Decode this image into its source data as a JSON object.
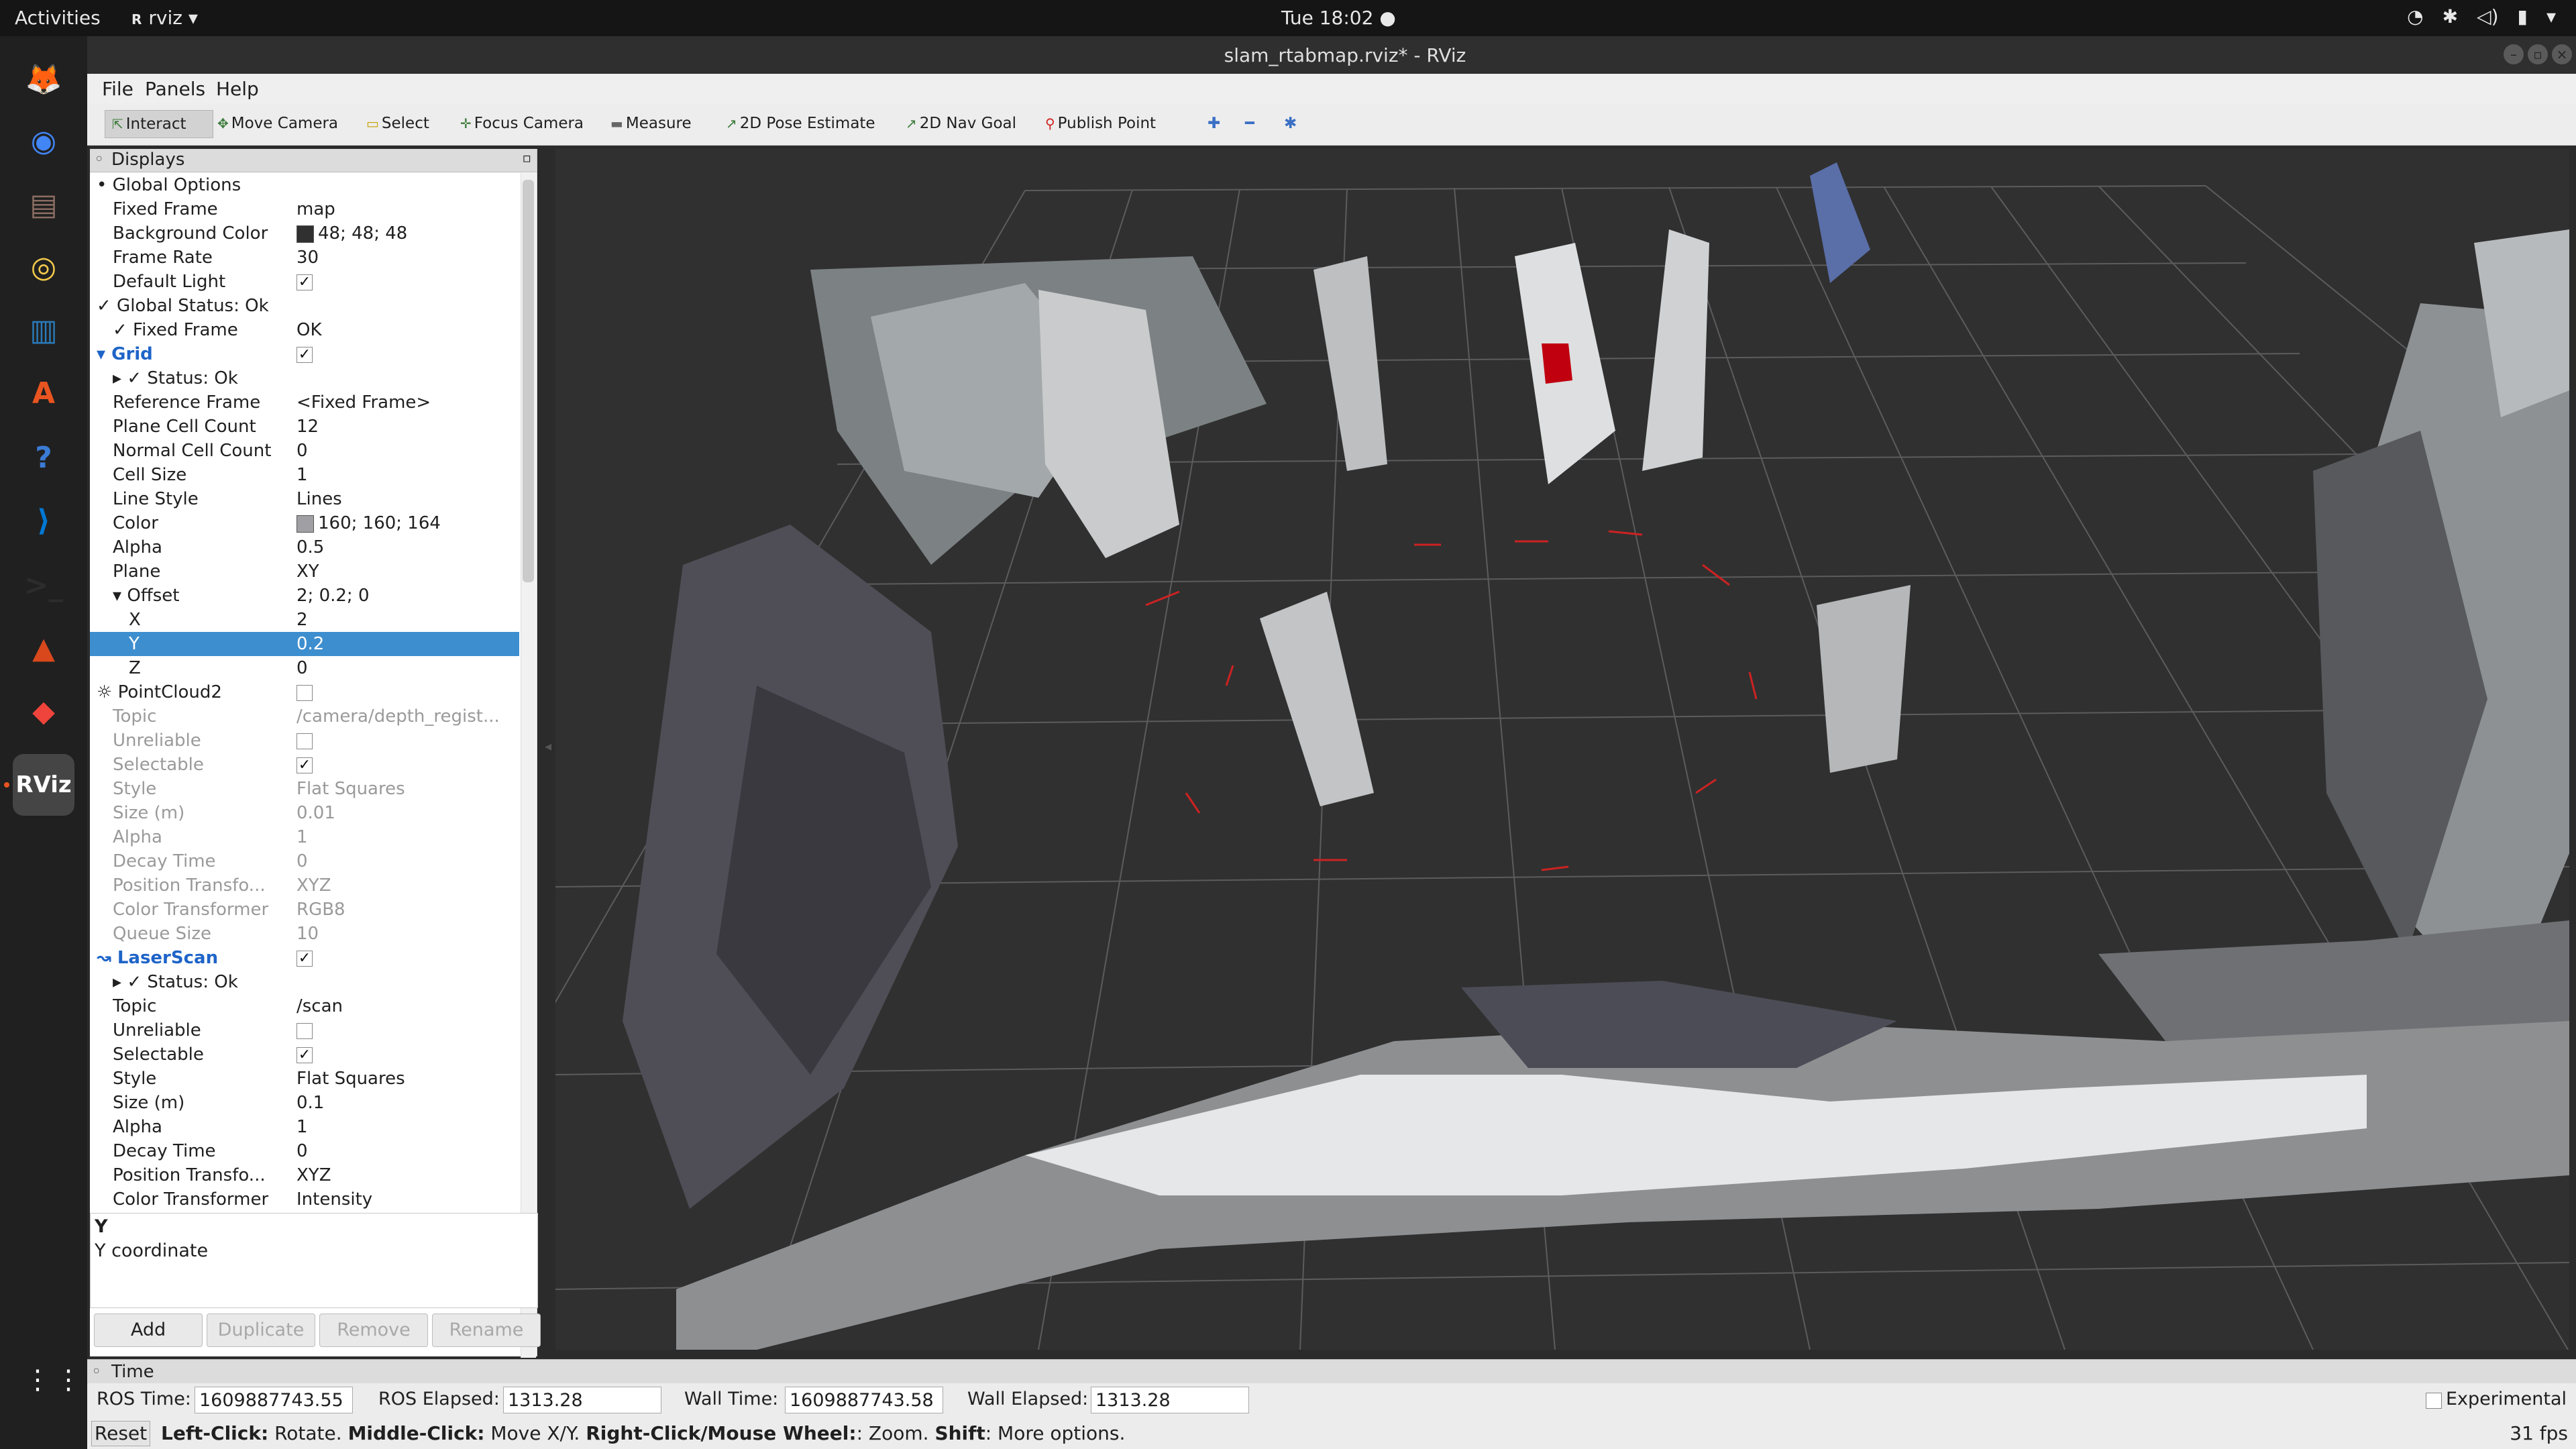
{
  "topbar": {
    "activities": "Activities",
    "app_name": "rviz",
    "clock": "Tue 18:02"
  },
  "window": {
    "title": "slam_rtabmap.rviz* - RViz"
  },
  "menu": [
    "File",
    "Panels",
    "Help"
  ],
  "toolbar": {
    "tools": [
      {
        "label": "Interact",
        "icon": "cursor-icon",
        "active": true
      },
      {
        "label": "Move Camera",
        "icon": "move-camera-icon",
        "active": false
      },
      {
        "label": "Select",
        "icon": "select-icon",
        "active": false
      },
      {
        "label": "Focus Camera",
        "icon": "focus-icon",
        "active": false
      },
      {
        "label": "Measure",
        "icon": "ruler-icon",
        "active": false
      },
      {
        "label": "2D Pose Estimate",
        "icon": "green-arrow-icon",
        "active": false
      },
      {
        "label": "2D Nav Goal",
        "icon": "green-arrow-icon",
        "active": false
      },
      {
        "label": "Publish Point",
        "icon": "red-pin-icon",
        "active": false
      }
    ]
  },
  "displays": {
    "title": "Displays",
    "rows": [
      {
        "key": "Global Options",
        "value": "",
        "indent": 0,
        "icon": "•"
      },
      {
        "key": "Fixed Frame",
        "value": "map",
        "indent": 1
      },
      {
        "key": "Background Color",
        "value": "48; 48; 48",
        "indent": 1,
        "swatch": "#303030"
      },
      {
        "key": "Frame Rate",
        "value": "30",
        "indent": 1
      },
      {
        "key": "Default Light",
        "value": "✓",
        "indent": 1,
        "check": true
      },
      {
        "key": "Global Status: Ok",
        "value": "",
        "indent": 0,
        "icon": "✓"
      },
      {
        "key": "Fixed Frame",
        "value": "OK",
        "indent": 1,
        "icon": "✓"
      },
      {
        "key": "Grid",
        "value": "✓",
        "indent": 0,
        "icon": "▾",
        "blue": true,
        "check": true
      },
      {
        "key": "Status: Ok",
        "value": "",
        "indent": 1,
        "icon": "▸ ✓"
      },
      {
        "key": "Reference Frame",
        "value": "<Fixed Frame>",
        "indent": 1
      },
      {
        "key": "Plane Cell Count",
        "value": "12",
        "indent": 1
      },
      {
        "key": "Normal Cell Count",
        "value": "0",
        "indent": 1
      },
      {
        "key": "Cell Size",
        "value": "1",
        "indent": 1
      },
      {
        "key": "Line Style",
        "value": "Lines",
        "indent": 1
      },
      {
        "key": "Color",
        "value": "160; 160; 164",
        "indent": 1,
        "swatch": "#a0a0a4"
      },
      {
        "key": "Alpha",
        "value": "0.5",
        "indent": 1
      },
      {
        "key": "Plane",
        "value": "XY",
        "indent": 1
      },
      {
        "key": "Offset",
        "value": "2; 0.2; 0",
        "indent": 1,
        "icon": "▾"
      },
      {
        "key": "X",
        "value": "2",
        "indent": 2
      },
      {
        "key": "Y",
        "value": "0.2",
        "indent": 2,
        "selected": true
      },
      {
        "key": "Z",
        "value": "0",
        "indent": 2
      },
      {
        "key": "PointCloud2",
        "value": "",
        "indent": 0,
        "icon": "☼",
        "check": true
      },
      {
        "key": "Topic",
        "value": "/camera/depth_regist...",
        "indent": 1,
        "dim": true
      },
      {
        "key": "Unreliable",
        "value": "",
        "indent": 1,
        "dim": true,
        "check": true
      },
      {
        "key": "Selectable",
        "value": "✓",
        "indent": 1,
        "dim": true,
        "check": true
      },
      {
        "key": "Style",
        "value": "Flat Squares",
        "indent": 1,
        "dim": true
      },
      {
        "key": "Size (m)",
        "value": "0.01",
        "indent": 1,
        "dim": true
      },
      {
        "key": "Alpha",
        "value": "1",
        "indent": 1,
        "dim": true
      },
      {
        "key": "Decay Time",
        "value": "0",
        "indent": 1,
        "dim": true
      },
      {
        "key": "Position Transfo...",
        "value": "XYZ",
        "indent": 1,
        "dim": true
      },
      {
        "key": "Color Transformer",
        "value": "RGB8",
        "indent": 1,
        "dim": true
      },
      {
        "key": "Queue Size",
        "value": "10",
        "indent": 1,
        "dim": true
      },
      {
        "key": "LaserScan",
        "value": "✓",
        "indent": 0,
        "icon": "↝",
        "blue": true,
        "check": true
      },
      {
        "key": "Status: Ok",
        "value": "",
        "indent": 1,
        "icon": "▸ ✓"
      },
      {
        "key": "Topic",
        "value": "/scan",
        "indent": 1
      },
      {
        "key": "Unreliable",
        "value": "",
        "indent": 1,
        "check": true
      },
      {
        "key": "Selectable",
        "value": "✓",
        "indent": 1,
        "check": true
      },
      {
        "key": "Style",
        "value": "Flat Squares",
        "indent": 1
      },
      {
        "key": "Size (m)",
        "value": "0.1",
        "indent": 1
      },
      {
        "key": "Alpha",
        "value": "1",
        "indent": 1
      },
      {
        "key": "Decay Time",
        "value": "0",
        "indent": 1
      },
      {
        "key": "Position Transfo...",
        "value": "XYZ",
        "indent": 1
      },
      {
        "key": "Color Transformer",
        "value": "Intensity",
        "indent": 1
      }
    ]
  },
  "description": {
    "title": "Y",
    "text": "Y coordinate"
  },
  "display_buttons": [
    {
      "label": "Add",
      "enabled": true
    },
    {
      "label": "Duplicate",
      "enabled": false
    },
    {
      "label": "Remove",
      "enabled": false
    },
    {
      "label": "Rename",
      "enabled": false
    }
  ],
  "time_panel": {
    "title": "Time",
    "ros_time_label": "ROS Time:",
    "ros_time": "1609887743.55",
    "ros_elapsed_label": "ROS Elapsed:",
    "ros_elapsed": "1313.28",
    "wall_time_label": "Wall Time:",
    "wall_time": "1609887743.58",
    "wall_elapsed_label": "Wall Elapsed:",
    "wall_elapsed": "1313.28",
    "experimental": "Experimental"
  },
  "status": {
    "reset": "Reset",
    "hint_parts": [
      {
        "text": "Left-Click:",
        "bold": true
      },
      {
        "text": " Rotate. ",
        "bold": false
      },
      {
        "text": "Middle-Click:",
        "bold": true
      },
      {
        "text": " Move X/Y. ",
        "bold": false
      },
      {
        "text": "Right-Click/Mouse Wheel:",
        "bold": true
      },
      {
        "text": ": Zoom. ",
        "bold": false
      },
      {
        "text": "Shift",
        "bold": true
      },
      {
        "text": ": More options.",
        "bold": false
      }
    ],
    "fps": "31 fps"
  },
  "dock": [
    {
      "name": "firefox-icon",
      "color": "#e66000",
      "glyph": "🦊"
    },
    {
      "name": "chrome-icon",
      "color": "#4285f4",
      "glyph": "◉"
    },
    {
      "name": "files-icon",
      "color": "#8d6e63",
      "glyph": "▤"
    },
    {
      "name": "rhythmbox-icon",
      "color": "#f2c94c",
      "glyph": "◎"
    },
    {
      "name": "writer-icon",
      "color": "#2a7ab9",
      "glyph": "▥"
    },
    {
      "name": "software-icon",
      "color": "#e95420",
      "glyph": "A"
    },
    {
      "name": "help-icon",
      "color": "#3a7bd5",
      "glyph": "?"
    },
    {
      "name": "vscode-icon",
      "color": "#0078d4",
      "glyph": "⟩"
    },
    {
      "name": "terminal-icon",
      "color": "#2c2c2c",
      "glyph": ">_"
    },
    {
      "name": "matlab-icon",
      "color": "#d9481c",
      "glyph": "▲"
    },
    {
      "name": "anydesk-icon",
      "color": "#ef443b",
      "glyph": "◆"
    },
    {
      "name": "rviz-icon",
      "color": "#3a3a3a",
      "glyph": "RViz"
    }
  ]
}
